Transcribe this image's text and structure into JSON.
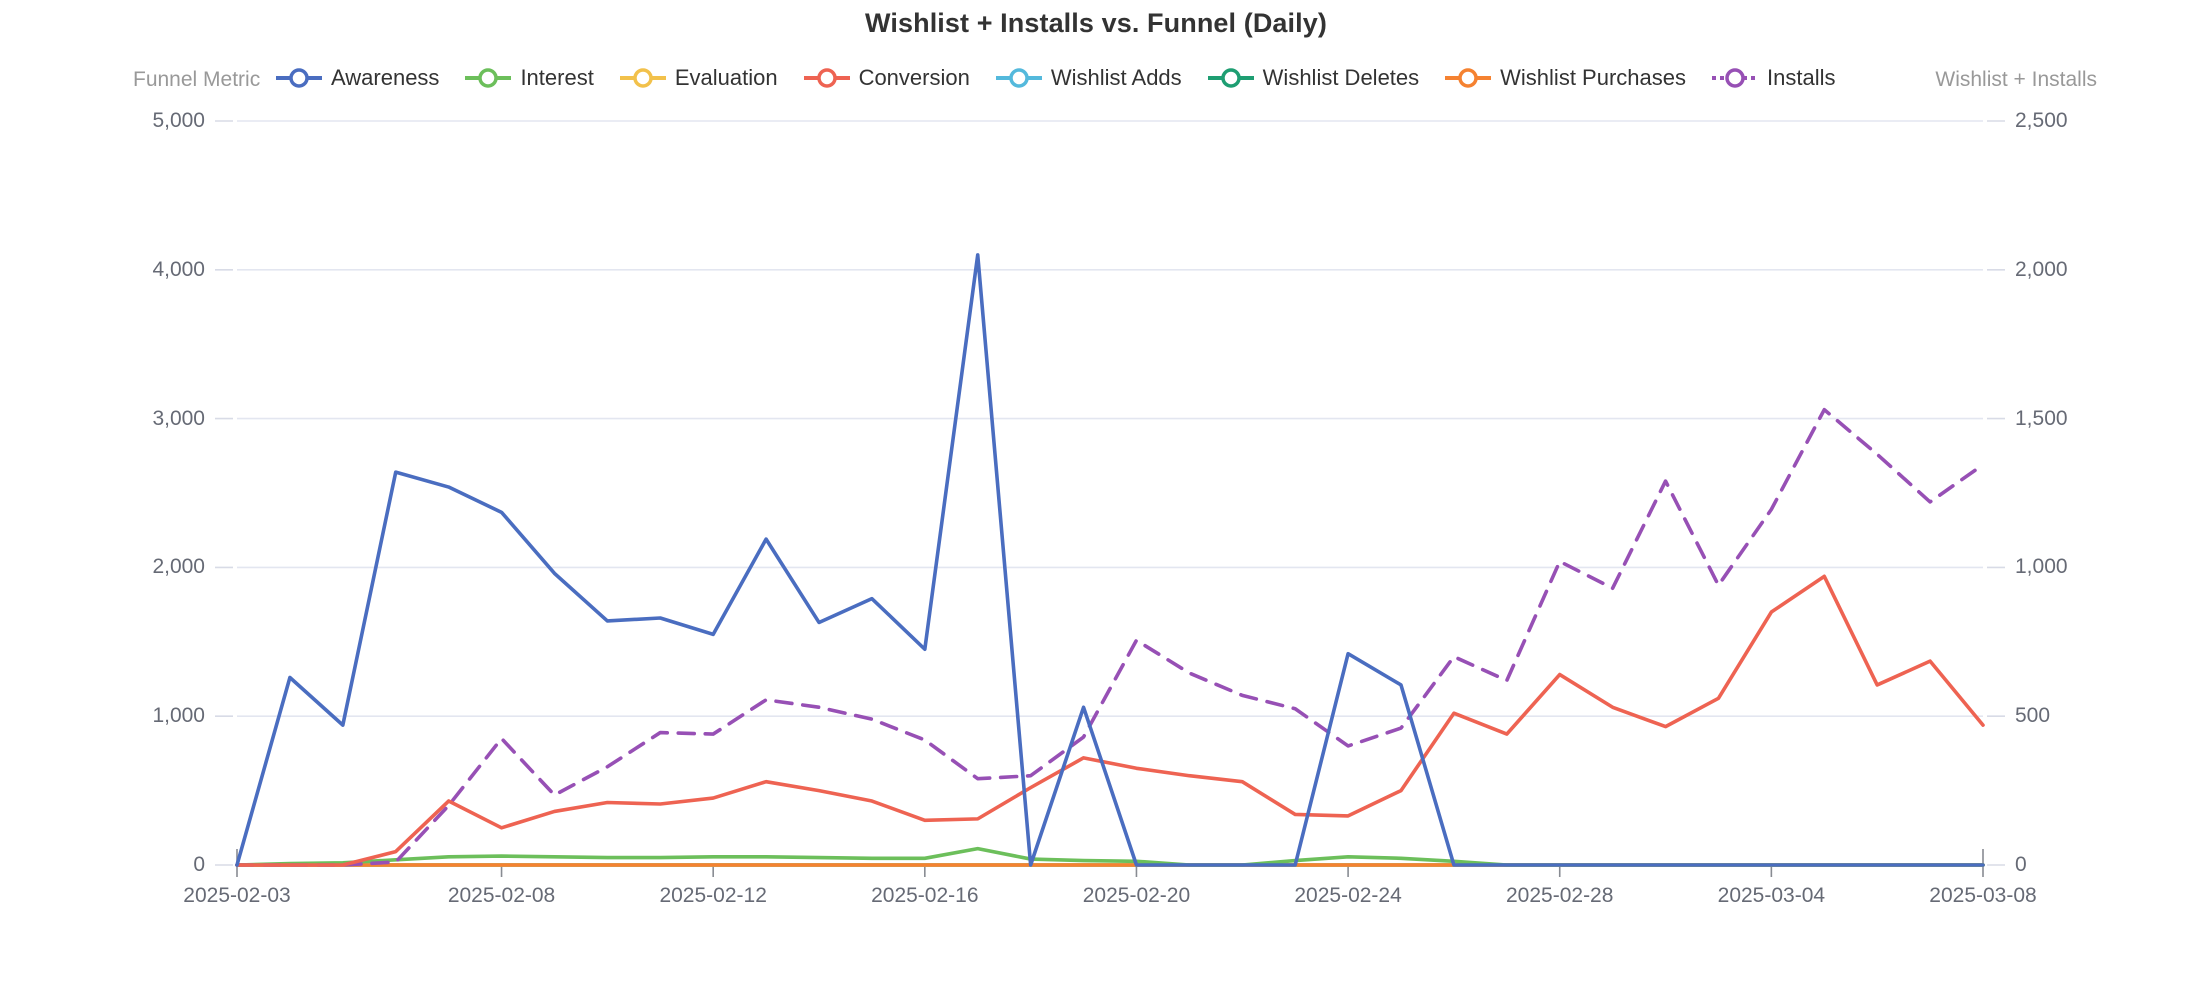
{
  "title": "Wishlist + Installs vs. Funnel (Daily)",
  "axis_titles": {
    "left": "Funnel Metric",
    "right": "Wishlist + Installs"
  },
  "legend": [
    {
      "label": "Awareness",
      "color": "#4A6DC0",
      "dash": false
    },
    {
      "label": "Interest",
      "color": "#6CBF5B",
      "dash": false
    },
    {
      "label": "Evaluation",
      "color": "#F2C14B",
      "dash": false
    },
    {
      "label": "Conversion",
      "color": "#EE6352",
      "dash": false
    },
    {
      "label": "Wishlist Adds",
      "color": "#54B9DC",
      "dash": false
    },
    {
      "label": "Wishlist Deletes",
      "color": "#1E9E72",
      "dash": false
    },
    {
      "label": "Wishlist Purchases",
      "color": "#F58231",
      "dash": false
    },
    {
      "label": "Installs",
      "color": "#9750B5",
      "dash": true
    }
  ],
  "chart_data": {
    "type": "line",
    "title": "Wishlist + Installs vs. Funnel (Daily)",
    "xlabel": "",
    "ylabel": "Funnel Metric",
    "y2label": "Wishlist + Installs",
    "grid": true,
    "legend_position": "top",
    "ylim": [
      0,
      5000
    ],
    "y2lim": [
      0,
      2500
    ],
    "yticks": [
      "0",
      "1,000",
      "2,000",
      "3,000",
      "4,000",
      "5,000"
    ],
    "ytick_values": [
      0,
      1000,
      2000,
      3000,
      4000,
      5000
    ],
    "y2ticks": [
      "0",
      "500",
      "1,000",
      "1,500",
      "2,000",
      "2,500"
    ],
    "y2tick_values": [
      0,
      500,
      1000,
      1500,
      2000,
      2500
    ],
    "xticks": [
      "2025-02-03",
      "2025-02-08",
      "2025-02-12",
      "2025-02-16",
      "2025-02-20",
      "2025-02-24",
      "2025-02-28",
      "2025-03-04",
      "2025-03-08"
    ],
    "xtick_indices": [
      0,
      5,
      9,
      13,
      17,
      21,
      25,
      29,
      33
    ],
    "x": [
      "2025-02-03",
      "2025-02-04",
      "2025-02-05",
      "2025-02-06",
      "2025-02-07",
      "2025-02-08",
      "2025-02-09",
      "2025-02-10",
      "2025-02-11",
      "2025-02-12",
      "2025-02-13",
      "2025-02-14",
      "2025-02-15",
      "2025-02-16",
      "2025-02-17",
      "2025-02-18",
      "2025-02-19",
      "2025-02-20",
      "2025-02-21",
      "2025-02-22",
      "2025-02-23",
      "2025-02-24",
      "2025-02-25",
      "2025-02-26",
      "2025-02-27",
      "2025-02-28",
      "2025-03-01",
      "2025-03-02",
      "2025-03-03",
      "2025-03-04",
      "2025-03-05",
      "2025-03-06",
      "2025-03-07",
      "2025-03-08"
    ],
    "series": [
      {
        "name": "Awareness",
        "axis": "left",
        "color": "#4A6DC0",
        "dash": false,
        "values": [
          0,
          1260,
          940,
          2640,
          2540,
          2370,
          1960,
          1640,
          1660,
          1550,
          2190,
          1630,
          1790,
          1450,
          4100,
          0,
          1060,
          0,
          0,
          0,
          0,
          1420,
          1210,
          0,
          0,
          0,
          0,
          0,
          0,
          0,
          0,
          0,
          0,
          0
        ]
      },
      {
        "name": "Interest",
        "axis": "left",
        "color": "#6CBF5B",
        "dash": false,
        "values": [
          0,
          10,
          15,
          35,
          55,
          60,
          55,
          50,
          50,
          55,
          55,
          50,
          45,
          45,
          110,
          40,
          30,
          25,
          0,
          0,
          30,
          55,
          45,
          25,
          0,
          0,
          0,
          0,
          0,
          0,
          0,
          0,
          0,
          0
        ]
      },
      {
        "name": "Evaluation",
        "axis": "left",
        "color": "#F2C14B",
        "dash": false,
        "values": [
          0,
          0,
          0,
          0,
          0,
          0,
          0,
          0,
          0,
          0,
          0,
          0,
          0,
          0,
          0,
          0,
          0,
          0,
          0,
          0,
          0,
          0,
          0,
          0,
          0,
          0,
          0,
          0,
          0,
          0,
          0,
          0,
          0,
          0
        ]
      },
      {
        "name": "Conversion",
        "axis": "left",
        "color": "#EE6352",
        "dash": false,
        "values": [
          0,
          0,
          0,
          90,
          430,
          250,
          360,
          420,
          410,
          450,
          560,
          500,
          430,
          300,
          310,
          520,
          720,
          650,
          600,
          560,
          340,
          330,
          500,
          1020,
          880,
          1280,
          1060,
          930,
          1120,
          1700,
          1940,
          1210,
          1370,
          940
        ]
      },
      {
        "name": "Wishlist Adds",
        "axis": "right",
        "color": "#54B9DC",
        "dash": false,
        "values": [
          0,
          0,
          0,
          0,
          0,
          0,
          0,
          0,
          0,
          0,
          0,
          0,
          0,
          0,
          0,
          0,
          0,
          0,
          0,
          0,
          0,
          0,
          0,
          0,
          0,
          0,
          0,
          0,
          0,
          0,
          0,
          0,
          0,
          0
        ]
      },
      {
        "name": "Wishlist Deletes",
        "axis": "right",
        "color": "#1E9E72",
        "dash": false,
        "values": [
          0,
          0,
          0,
          0,
          0,
          0,
          0,
          0,
          0,
          0,
          0,
          0,
          0,
          0,
          0,
          0,
          0,
          0,
          0,
          0,
          0,
          0,
          0,
          0,
          0,
          0,
          0,
          0,
          0,
          0,
          0,
          0,
          0,
          0
        ]
      },
      {
        "name": "Wishlist Purchases",
        "axis": "right",
        "color": "#F58231",
        "dash": false,
        "values": [
          0,
          0,
          0,
          0,
          0,
          0,
          0,
          0,
          0,
          0,
          0,
          0,
          0,
          0,
          0,
          0,
          0,
          0,
          0,
          0,
          0,
          0,
          0,
          0,
          0,
          0,
          0,
          0,
          0,
          0,
          0,
          0,
          0,
          0
        ]
      },
      {
        "name": "Installs",
        "axis": "right",
        "color": "#9750B5",
        "dash": true,
        "values": [
          0,
          0,
          0,
          10,
          200,
          425,
          235,
          330,
          445,
          440,
          555,
          530,
          490,
          420,
          290,
          300,
          430,
          755,
          645,
          570,
          525,
          400,
          460,
          700,
          620,
          1020,
          930,
          1290,
          940,
          1195,
          1530,
          1380,
          1220,
          1345
        ]
      }
    ]
  }
}
